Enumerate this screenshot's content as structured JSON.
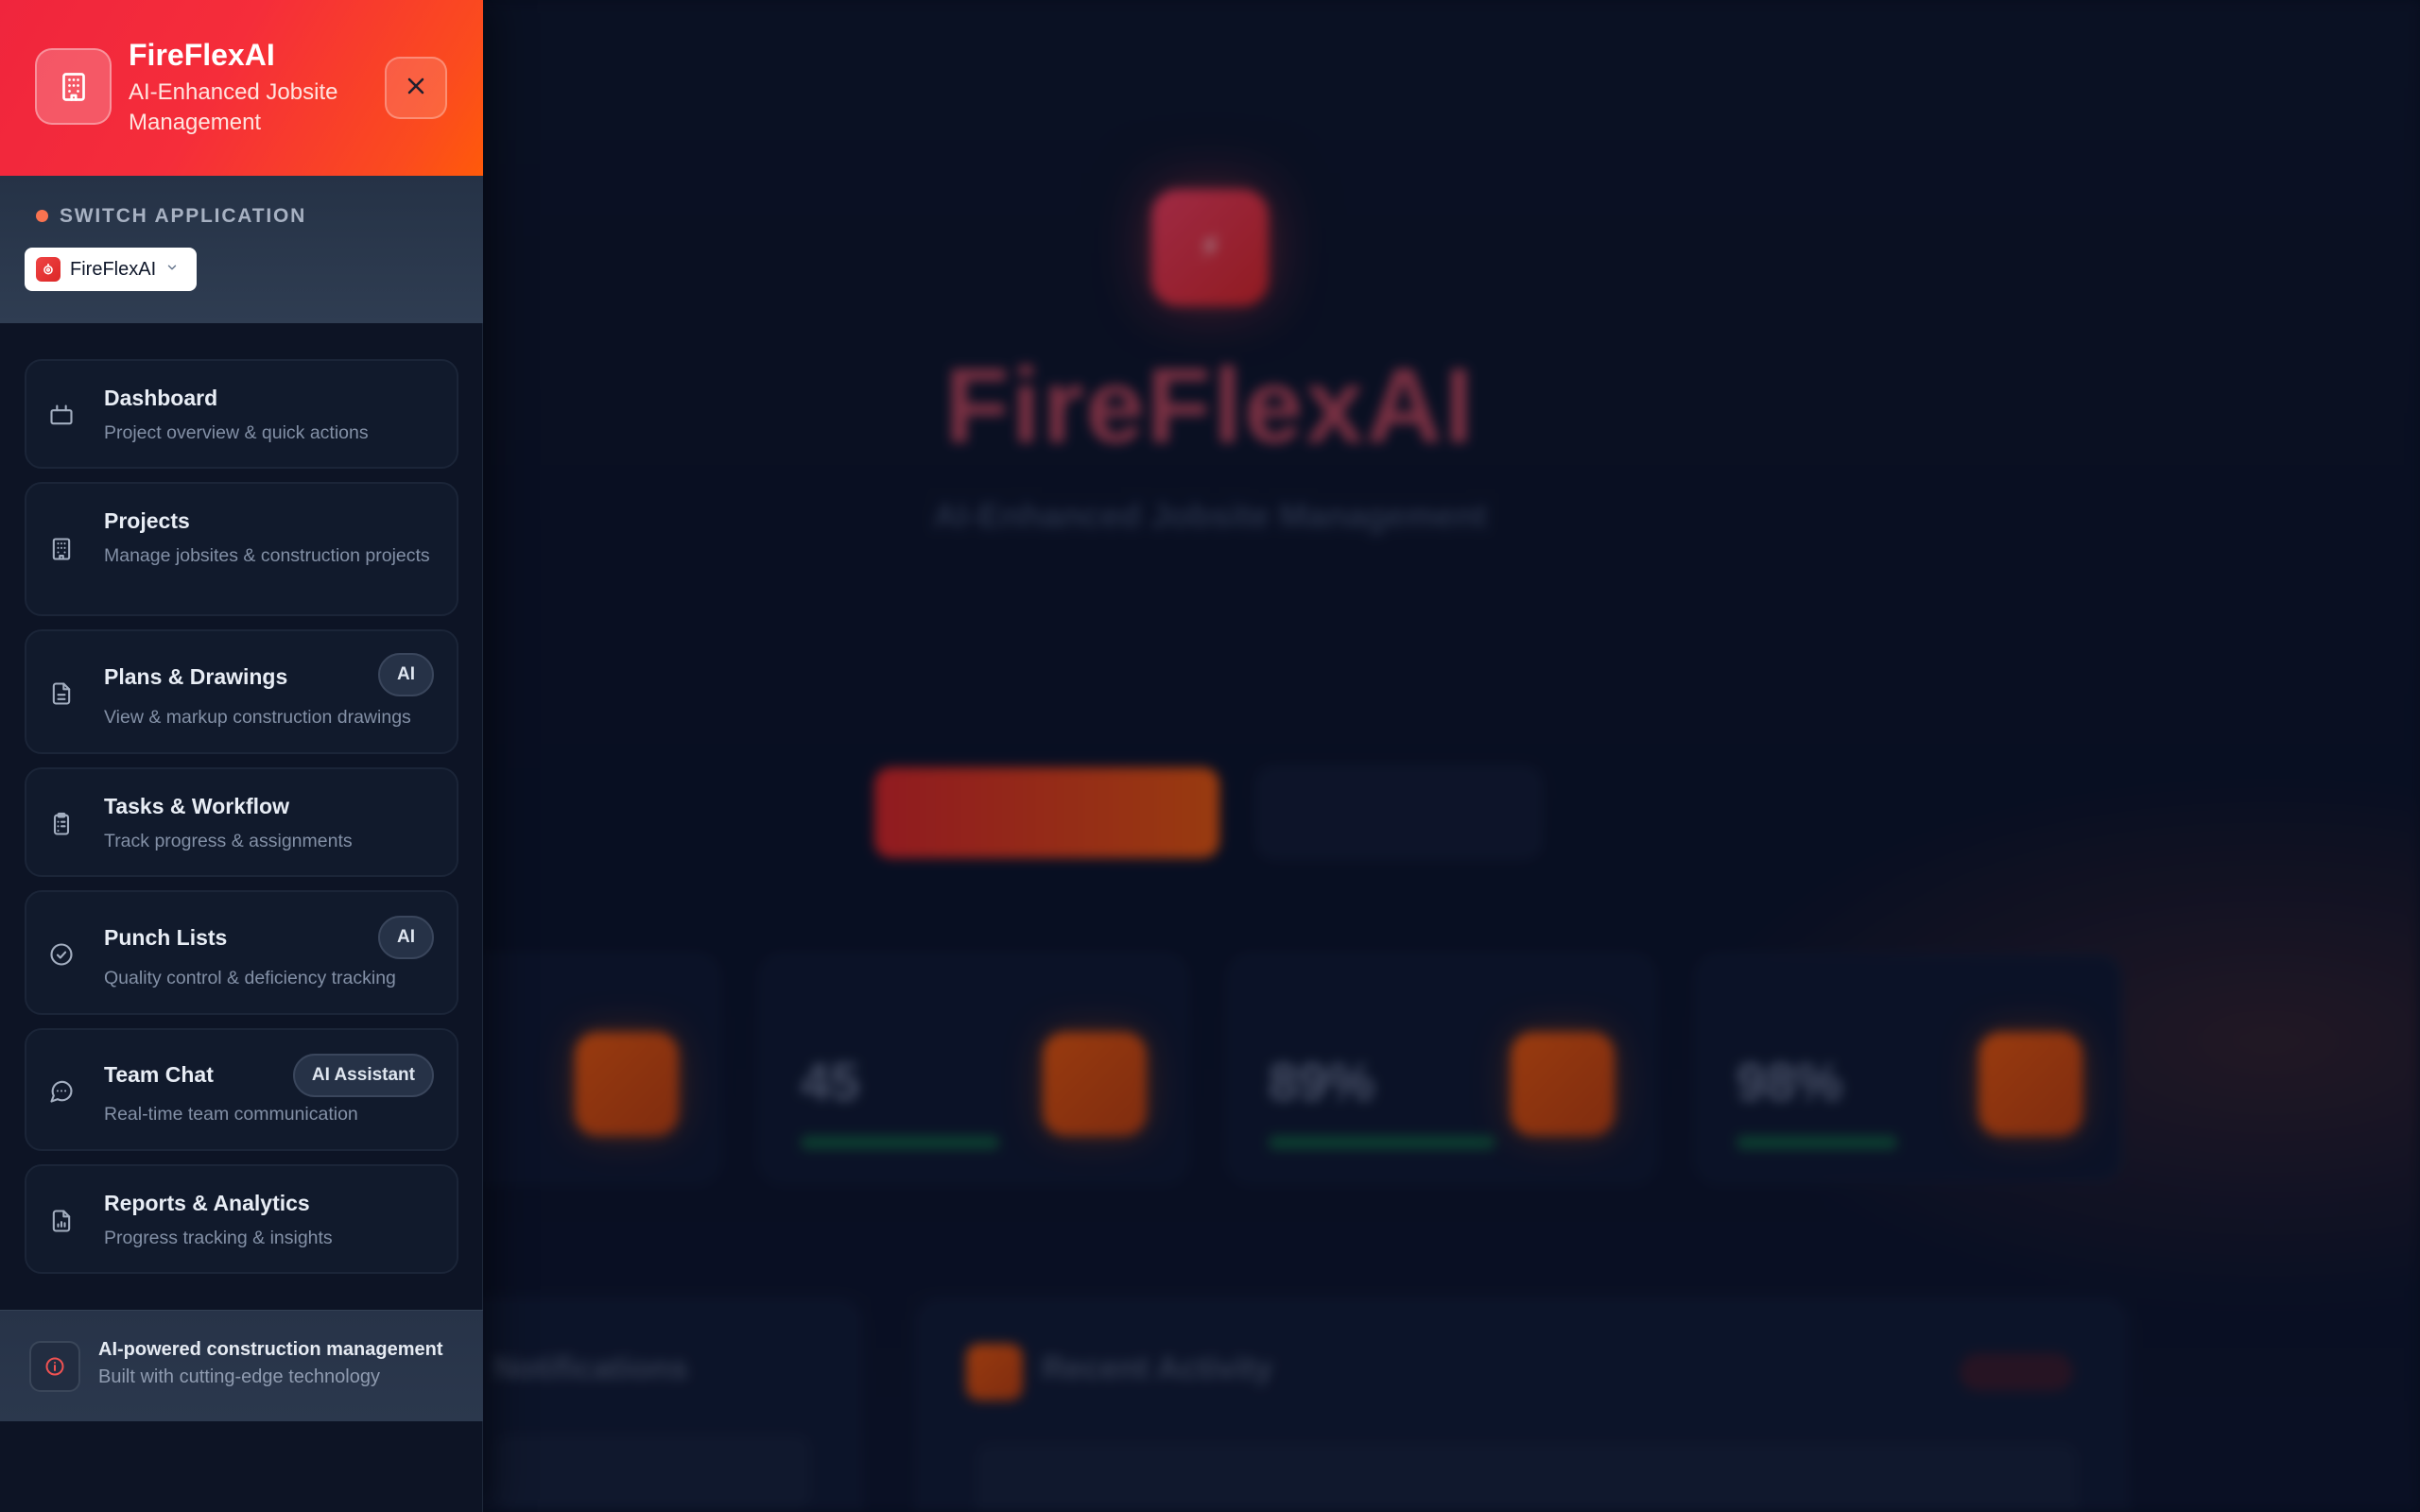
{
  "background": {
    "hero_title": "FireFlexAI",
    "hero_subtitle": "AI-Enhanced Jobsite Management",
    "hero_description": "",
    "primary_cta": "",
    "secondary_cta": "",
    "stats": [
      {
        "label": "",
        "value": ""
      },
      {
        "label": "",
        "value": "45"
      },
      {
        "label": "",
        "value": "89%"
      },
      {
        "label": "",
        "value": "98%"
      }
    ],
    "panels": [
      {
        "title": "Notifications"
      },
      {
        "title": "Recent Activity"
      }
    ]
  },
  "sidebar": {
    "brand": {
      "name": "FireFlexAI",
      "tagline": "AI-Enhanced Jobsite Management",
      "logo_icon": "building-icon"
    },
    "close_icon": "close-icon",
    "switcher": {
      "label": "SWITCH APPLICATION",
      "selected": "FireFlexAI",
      "options": [
        "FireFlexAI"
      ]
    },
    "nav": [
      {
        "title": "Dashboard",
        "description": "Project overview & quick actions",
        "icon": "monitor-icon",
        "badge": ""
      },
      {
        "title": "Projects",
        "description": "Manage jobsites & construction projects",
        "icon": "building-icon",
        "badge": ""
      },
      {
        "title": "Plans & Drawings",
        "description": "View & markup construction drawings",
        "icon": "document-icon",
        "badge": "AI"
      },
      {
        "title": "Tasks & Workflow",
        "description": "Track progress & assignments",
        "icon": "clipboard-icon",
        "badge": ""
      },
      {
        "title": "Punch Lists",
        "description": "Quality control & deficiency tracking",
        "icon": "check-circle-icon",
        "badge": "AI"
      },
      {
        "title": "Team Chat",
        "description": "Real-time team communication",
        "icon": "chat-icon",
        "badge": "AI Assistant"
      },
      {
        "title": "Reports & Analytics",
        "description": "Progress tracking & insights",
        "icon": "report-icon",
        "badge": ""
      }
    ],
    "footer": {
      "title": "AI-powered construction management",
      "subtitle": "Built with cutting-edge technology",
      "icon": "info-icon"
    }
  },
  "colors": {
    "brand_red": "#f0253d",
    "brand_orange": "#ff5a0a",
    "sidebar_bg": "#0d1425",
    "card_bg": "#111a2c"
  }
}
